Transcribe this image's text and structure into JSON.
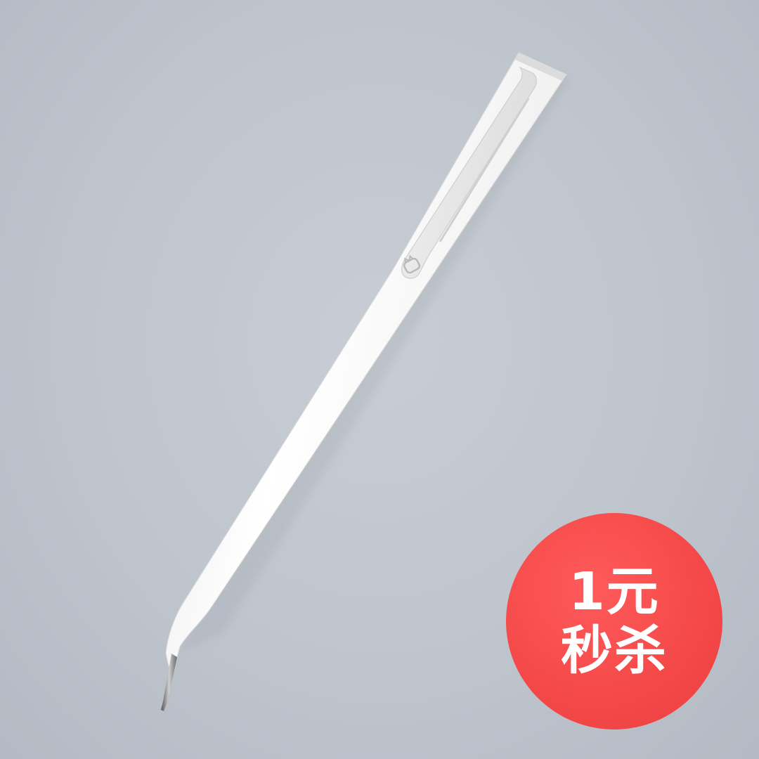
{
  "product": {
    "name": "white gel pen",
    "logo_icon": "mijia-cat-logo-icon"
  },
  "badge": {
    "line1": "1元",
    "line2": "秒杀",
    "color": "#f44848",
    "text_color": "#ffffff"
  },
  "colors": {
    "background": "#bfc5cd",
    "pen_body": "#f7f7f7",
    "clip": "#e7e7e7"
  }
}
